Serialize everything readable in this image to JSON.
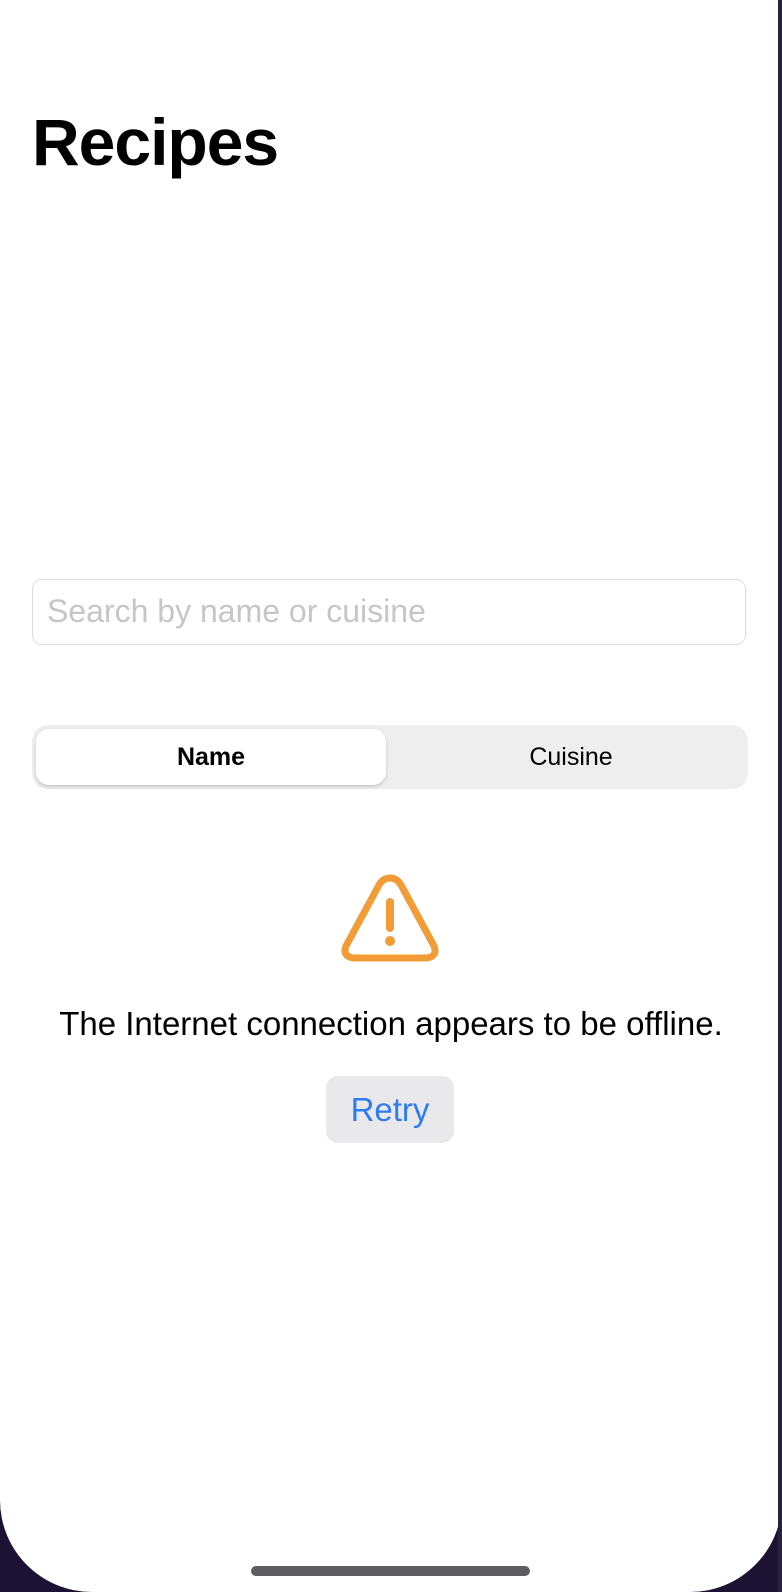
{
  "header": {
    "title": "Recipes"
  },
  "search": {
    "placeholder": "Search by name or cuisine",
    "value": ""
  },
  "sort_control": {
    "options": [
      "Name",
      "Cuisine"
    ],
    "selected": "Name"
  },
  "error_state": {
    "icon": "warning-triangle-icon",
    "icon_color": "#F29C38",
    "message": "The Internet connection appears to be offline.",
    "retry_label": "Retry",
    "retry_color": "#2F7BF0"
  }
}
